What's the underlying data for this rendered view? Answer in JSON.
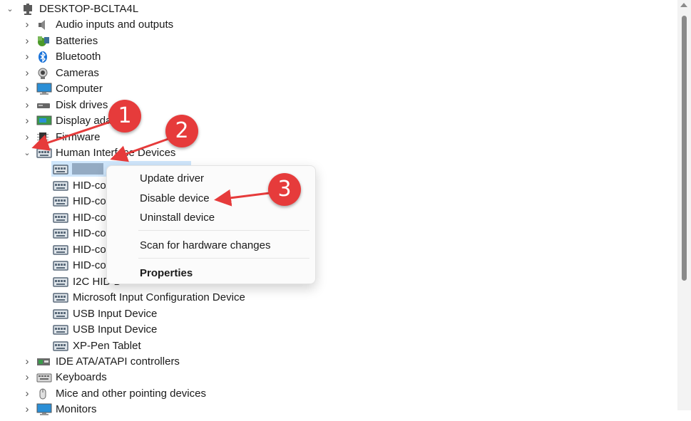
{
  "tree": {
    "computer_name": "DESKTOP-BCLTA4L",
    "categories": [
      {
        "label": "Audio inputs and outputs",
        "icon": "speaker-icon"
      },
      {
        "label": "Batteries",
        "icon": "battery-icon"
      },
      {
        "label": "Bluetooth",
        "icon": "bluetooth-icon"
      },
      {
        "label": "Cameras",
        "icon": "camera-icon"
      },
      {
        "label": "Computer",
        "icon": "monitor-icon"
      },
      {
        "label": "Disk drives",
        "icon": "disk-drive-icon"
      },
      {
        "label": "Display adapters",
        "icon": "display-adapter-icon"
      },
      {
        "label": "Firmware",
        "icon": "firmware-chip-icon"
      },
      {
        "label": "Human Interface Devices",
        "icon": "hid-icon"
      },
      {
        "label": "IDE ATA/ATAPI controllers",
        "icon": "ide-controller-icon"
      },
      {
        "label": "Keyboards",
        "icon": "keyboard-icon"
      },
      {
        "label": "Mice and other pointing devices",
        "icon": "mouse-icon"
      },
      {
        "label": "Monitors",
        "icon": "monitor-icon"
      }
    ],
    "hid_children": [
      {
        "label": ""
      },
      {
        "label": "HID-co"
      },
      {
        "label": "HID-co"
      },
      {
        "label": "HID-co"
      },
      {
        "label": "HID-co"
      },
      {
        "label": "HID-co"
      },
      {
        "label": "HID-co"
      },
      {
        "label": "I2C HID D"
      },
      {
        "label": "Microsoft Input Configuration Device"
      },
      {
        "label": "USB Input Device"
      },
      {
        "label": "USB Input Device"
      },
      {
        "label": "XP-Pen Tablet"
      }
    ]
  },
  "context_menu": {
    "update_driver": "Update driver",
    "disable_device": "Disable device",
    "uninstall_device": "Uninstall device",
    "scan_hardware": "Scan for hardware changes",
    "properties": "Properties"
  },
  "annotations": {
    "step1": "1",
    "step2": "2",
    "step3": "3"
  },
  "colors": {
    "selection": "#cfe6fb",
    "annotation_red": "#e63b3b",
    "hid_icon": "#5a6a7a"
  }
}
